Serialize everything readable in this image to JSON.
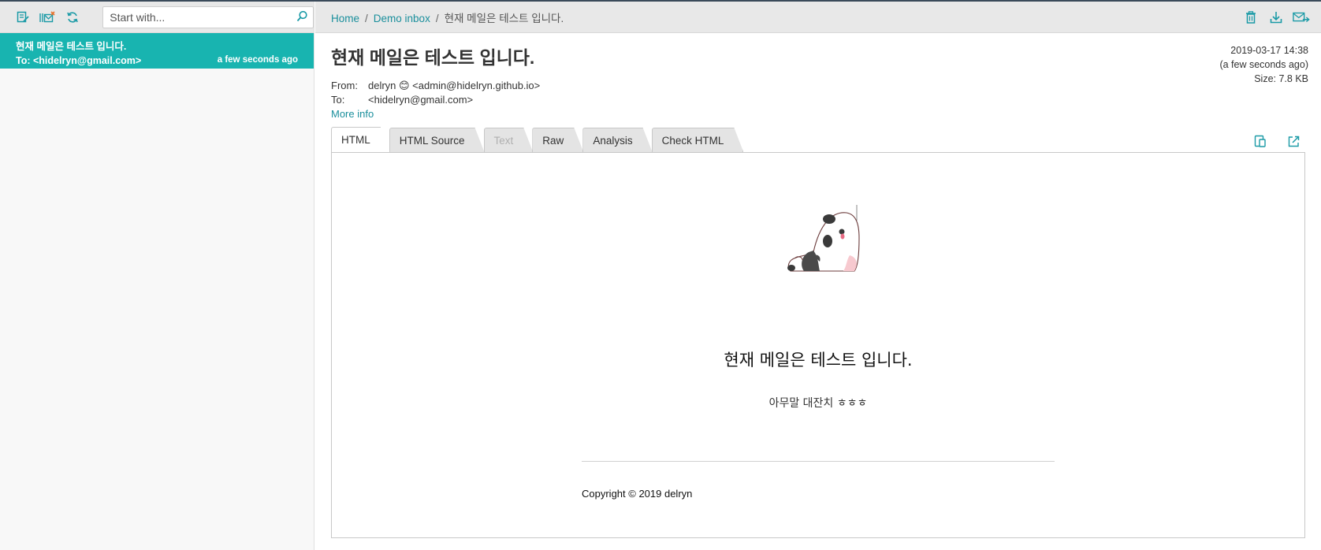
{
  "left_toolbar": {
    "search_placeholder": "Start with..."
  },
  "messages": [
    {
      "subject": "현재 메일은 테스트 입니다.",
      "to": "To: <hidelryn@gmail.com>",
      "time": "a few seconds ago"
    }
  ],
  "breadcrumb": {
    "home": "Home",
    "inbox": "Demo inbox",
    "current": "현재 메일은 테스트 입니다.",
    "sep": "/"
  },
  "email": {
    "subject": "현재 메일은 테스트 입니다.",
    "date": "2019-03-17 14:38",
    "relative": "(a few seconds ago)",
    "size": "Size: 7.8 KB",
    "from_label": "From:",
    "from_value": "delryn 😊 <admin@hidelryn.github.io>",
    "to_label": "To:",
    "to_value": "<hidelryn@gmail.com>",
    "more_info": "More info"
  },
  "tabs": [
    {
      "label": "HTML",
      "state": "active"
    },
    {
      "label": "HTML Source",
      "state": "normal"
    },
    {
      "label": "Text",
      "state": "disabled"
    },
    {
      "label": "Raw",
      "state": "normal"
    },
    {
      "label": "Analysis",
      "state": "normal"
    },
    {
      "label": "Check HTML",
      "state": "normal"
    }
  ],
  "body": {
    "title": "현재 메일은 테스트 입니다.",
    "text": "아무말 대잔치 ㅎㅎㅎ",
    "footer": "Copyright © 2019 delryn"
  },
  "icons": {
    "compose": "compose-icon",
    "mark_read": "mark-read-icon",
    "refresh": "refresh-icon",
    "search": "search-icon",
    "delete": "trash-icon",
    "download": "download-icon",
    "forward": "forward-mail-icon",
    "responsive": "responsive-view-icon",
    "open_external": "open-external-icon",
    "illustration": "panda-illustration"
  },
  "colors": {
    "accent": "#18b4b0",
    "link": "#1a8f9c",
    "toolbar_bg": "#e8e8e8"
  }
}
